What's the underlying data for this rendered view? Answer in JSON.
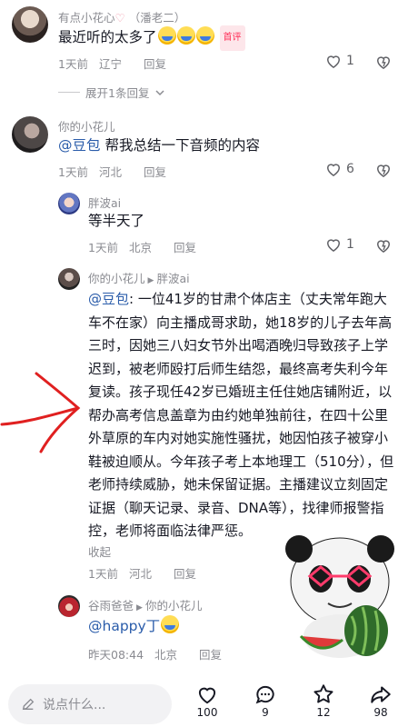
{
  "comments": [
    {
      "author": "有点小花心",
      "author_tag": "（潘老二）",
      "text": "最近听的太多了",
      "badge": "首评",
      "time": "1天前",
      "location": "辽宁",
      "reply_label": "回复",
      "likes": "1",
      "expand_label": "展开1条回复"
    },
    {
      "author": "你的小花儿",
      "mention": "@豆包",
      "text": " 帮我总结一下音频的内容",
      "time": "1天前",
      "location": "河北",
      "reply_label": "回复",
      "likes": "6"
    },
    {
      "author": "胖波ai",
      "text": "等半天了",
      "time": "1天前",
      "location": "北京",
      "reply_label": "回复",
      "likes": "1"
    },
    {
      "author": "你的小花儿",
      "reply_to": "胖波ai",
      "mention": "@豆包",
      "text": ": 一位41岁的甘肃个体店主（丈夫常年跑大车不在家）向主播成哥求助，她18岁的儿子去年高三时，因她三八妇女节外出喝酒晚归导致孩子上学迟到，被老师殴打后师生结怨，最终高考失利今年复读。孩子现任42岁已婚班主任住她店铺附近，以帮办高考信息盖章为由约她单独前往，在四十公里外草原的车内对她实施性骚扰，她因怕孩子被穿小鞋被迫顺从。今年孩子考上本地理工（510分），但老师持续威胁，她未保留证据。主播建议立刻固定证据（聊天记录、录音、DNA等），找律师报警指控，老师将面临法律严惩。",
      "collapse_label": "收起",
      "time": "1天前",
      "location": "河北",
      "reply_label": "回复"
    },
    {
      "author": "谷雨爸爸",
      "reply_to": "你的小花儿",
      "mention": "@happy丁",
      "time": "昨天08:44",
      "location": "北京",
      "reply_label": "回复"
    }
  ],
  "bottom_bar": {
    "input_placeholder": "说点什么...",
    "like_count": "100",
    "comment_count": "9",
    "favorite_count": "12",
    "share_count": "98"
  },
  "colors": {
    "accent_red": "#fe2c55",
    "mention_blue": "#2a5caa",
    "meta_gray": "#8a8b91",
    "annotation_red": "#e02020"
  }
}
